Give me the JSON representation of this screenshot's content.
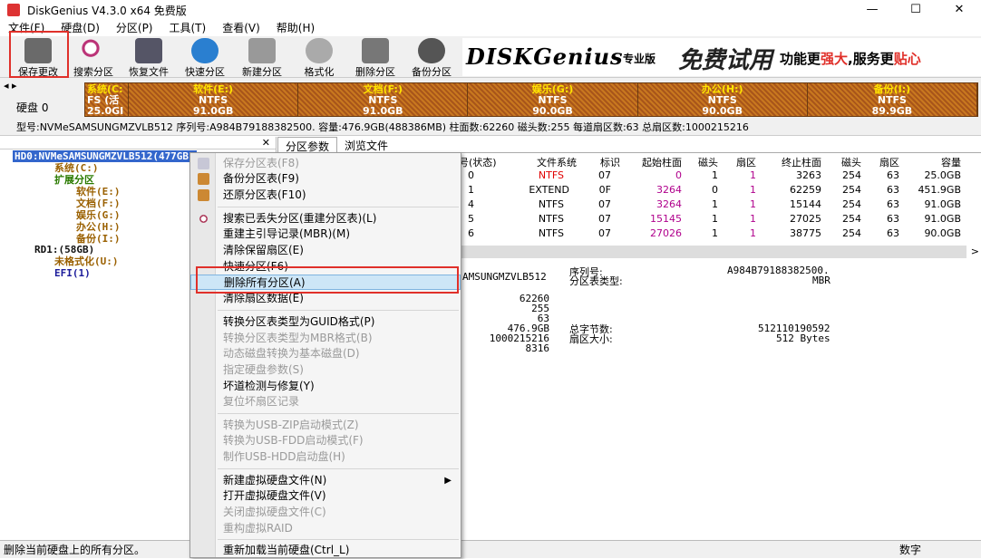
{
  "window": {
    "title": "DiskGenius V4.3.0 x64 免费版",
    "minimize": "—",
    "maximize": "☐",
    "close": "✕"
  },
  "menu": [
    "文件(F)",
    "硬盘(D)",
    "分区(P)",
    "工具(T)",
    "查看(V)",
    "帮助(H)"
  ],
  "toolbar": [
    {
      "label": "保存更改",
      "icon": "save-icon"
    },
    {
      "label": "搜索分区",
      "icon": "search-icon"
    },
    {
      "label": "恢复文件",
      "icon": "recover-icon"
    },
    {
      "label": "快速分区",
      "icon": "quick-partition-icon"
    },
    {
      "label": "新建分区",
      "icon": "new-partition-icon"
    },
    {
      "label": "格式化",
      "icon": "format-icon"
    },
    {
      "label": "删除分区",
      "icon": "delete-icon"
    },
    {
      "label": "备份分区",
      "icon": "backup-icon"
    }
  ],
  "banner": {
    "logo": "DISKGenius",
    "edition": "专业版",
    "trial": "免费试用",
    "slogan_a": "功能更",
    "slogan_b": "强大",
    "slogan_c": ",服务更",
    "slogan_d": "贴心"
  },
  "disk_nav": {
    "label": "硬盘 0"
  },
  "partitions_bar": [
    {
      "name": "系统(C:",
      "fs": "FS (活",
      "size": "25.0GI"
    },
    {
      "name": "软件(E:)",
      "fs": "NTFS",
      "size": "91.0GB"
    },
    {
      "name": "文档(F:)",
      "fs": "NTFS",
      "size": "91.0GB"
    },
    {
      "name": "娱乐(G:)",
      "fs": "NTFS",
      "size": "90.0GB"
    },
    {
      "name": "办公(H:)",
      "fs": "NTFS",
      "size": "90.0GB"
    },
    {
      "name": "备份(I:)",
      "fs": "NTFS",
      "size": "89.9GB"
    }
  ],
  "disk_info": "型号:NVMeSAMSUNGMZVLB512   序列号:A984B79188382500.   容量:476.9GB(488386MB)   柱面数:62260   磁头数:255   每道扇区数:63   总扇区数:1000215216",
  "tree": {
    "hd0": "HD0:NVMeSAMSUNGMZVLB512(477GB)",
    "system": "系统(C:)",
    "extended": "扩展分区",
    "software": "软件(E:)",
    "docs": "文档(F:)",
    "ent": "娱乐(G:)",
    "office": "办公(H:)",
    "backup": "备份(I:)",
    "rd1": "RD1:(58GB)",
    "unformatted": "未格式化(U:)",
    "efi": "EFI(1)"
  },
  "tabs": [
    "分区参数",
    "浏览文件"
  ],
  "table": {
    "headers": [
      "号(状态)",
      "文件系统",
      "标识",
      "起始柱面",
      "磁头",
      "扇区",
      "终止柱面",
      "磁头",
      "扇区",
      "容量"
    ],
    "rows": [
      [
        "0",
        "NTFS",
        "07",
        "0",
        "1",
        "1",
        "3263",
        "254",
        "63",
        "25.0GB"
      ],
      [
        "1",
        "EXTEND",
        "0F",
        "3264",
        "0",
        "1",
        "62259",
        "254",
        "63",
        "451.9GB"
      ],
      [
        "4",
        "NTFS",
        "07",
        "3264",
        "1",
        "1",
        "15144",
        "254",
        "63",
        "91.0GB"
      ],
      [
        "5",
        "NTFS",
        "07",
        "15145",
        "1",
        "1",
        "27025",
        "254",
        "63",
        "91.0GB"
      ],
      [
        "6",
        "NTFS",
        "07",
        "27026",
        "1",
        "1",
        "38775",
        "254",
        "63",
        "90.0GB"
      ]
    ],
    "scroll_arrow": ">"
  },
  "details": {
    "model": "AMSUNGMZVLB512",
    "serial_label": "序列号:",
    "serial": "A984B79188382500.",
    "pt_label": "分区表类型:",
    "pt": "MBR",
    "cyl": "62260",
    "heads": "255",
    "spt": "63",
    "cap": "476.9GB",
    "total_sectors": "1000215216",
    "v8316": "8316",
    "total_bytes_label": "总字节数:",
    "total_bytes": "512110190592",
    "sector_size_label": "扇区大小:",
    "sector_size": "512 Bytes"
  },
  "context_menu": [
    {
      "label": "保存分区表(F8)",
      "disabled": true,
      "icon": "save-icon"
    },
    {
      "label": "备份分区表(F9)",
      "disabled": false,
      "icon": "backup-table-icon"
    },
    {
      "label": "还原分区表(F10)",
      "disabled": false,
      "icon": "restore-table-icon"
    },
    {
      "label": "搜索已丢失分区(重建分区表)(L)",
      "disabled": false,
      "icon": "search-icon"
    },
    {
      "label": "重建主引导记录(MBR)(M)",
      "disabled": false
    },
    {
      "label": "清除保留扇区(E)",
      "disabled": false
    },
    {
      "label": "快速分区(F6)",
      "disabled": false
    },
    {
      "label": "删除所有分区(A)",
      "disabled": false,
      "selected": true
    },
    {
      "label": "清除扇区数据(E)",
      "disabled": false
    },
    {
      "label": "转换分区表类型为GUID格式(P)",
      "disabled": false
    },
    {
      "label": "转换分区表类型为MBR格式(B)",
      "disabled": true
    },
    {
      "label": "动态磁盘转换为基本磁盘(D)",
      "disabled": true
    },
    {
      "label": "指定硬盘参数(S)",
      "disabled": true
    },
    {
      "label": "坏道检测与修复(Y)",
      "disabled": false
    },
    {
      "label": "复位坏扇区记录",
      "disabled": true
    },
    {
      "label": "转换为USB-ZIP启动模式(Z)",
      "disabled": true
    },
    {
      "label": "转换为USB-FDD启动模式(F)",
      "disabled": true
    },
    {
      "label": "制作USB-HDD启动盘(H)",
      "disabled": true
    },
    {
      "label": "新建虚拟硬盘文件(N)",
      "disabled": false,
      "submenu": true
    },
    {
      "label": "打开虚拟硬盘文件(V)",
      "disabled": false
    },
    {
      "label": "关闭虚拟硬盘文件(C)",
      "disabled": true
    },
    {
      "label": "重构虚拟RAID",
      "disabled": true
    },
    {
      "label": "重新加载当前硬盘(Ctrl_L)",
      "disabled": false
    }
  ],
  "status": {
    "text": "删除当前硬盘上的所有分区。",
    "numlock": "数字"
  }
}
